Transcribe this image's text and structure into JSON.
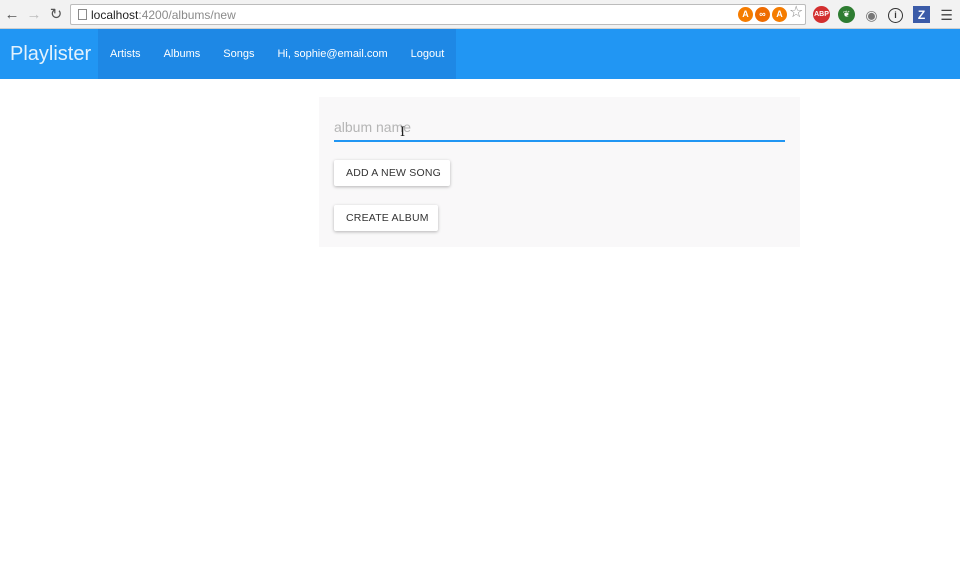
{
  "browser": {
    "url_host": "localhost",
    "url_path": ":4200/albums/new",
    "extensions": [
      {
        "name": "avast-a-icon",
        "label": "A",
        "color": "#f57c00"
      },
      {
        "name": "infinity-icon",
        "label": "∞",
        "color": "#ef6c00"
      },
      {
        "name": "avast-a-icon-2",
        "label": "A",
        "color": "#f57c00"
      },
      {
        "name": "adblock-icon",
        "label": "ABP",
        "color": "#d32f2f"
      },
      {
        "name": "evernote-icon",
        "label": "❦",
        "color": "#2e7d32"
      },
      {
        "name": "chameleon-icon",
        "label": "◉",
        "color": "#777777"
      },
      {
        "name": "info-icon",
        "label": "i",
        "color": "#333333"
      },
      {
        "name": "zotero-icon",
        "label": "Z",
        "color": "#3b5ba8"
      }
    ]
  },
  "navbar": {
    "brand": "Playlister",
    "links": [
      "Artists",
      "Albums",
      "Songs",
      "Hi, sophie@email.com",
      "Logout"
    ]
  },
  "form": {
    "album_name_placeholder": "album name",
    "album_name_value": "",
    "add_song_label": "ADD A NEW SONG",
    "create_album_label": "CREATE ALBUM"
  },
  "colors": {
    "navbar": "#2196f3",
    "nav_group": "#1e88e5",
    "input_underline": "#2196f3"
  }
}
